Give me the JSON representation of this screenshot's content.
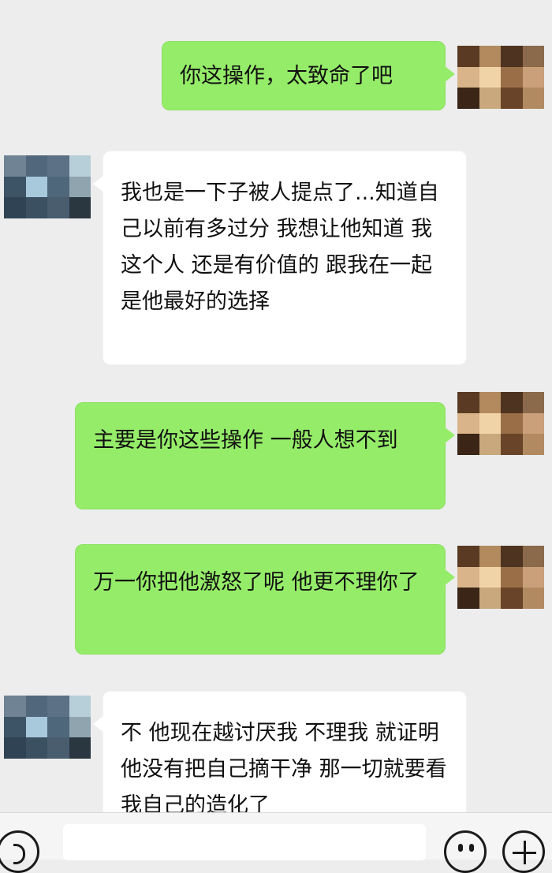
{
  "messages": [
    {
      "sender": "me",
      "text": "你这操作，太致命了吧"
    },
    {
      "sender": "them",
      "text": "我也是一下子被人提点了...知道自己以前有多过分 我想让他知道 我这个人 还是有价值的 跟我在一起 是他最好的选择"
    },
    {
      "sender": "me",
      "text": "主要是你这些操作 一般人想不到"
    },
    {
      "sender": "me",
      "text": "万一你把他激怒了呢 他更不理你了"
    },
    {
      "sender": "them",
      "text": "不 他现在越讨厌我 不理我 就证明他没有把自己摘干净 那一切就要看我自己的造化了"
    }
  ],
  "avatars": {
    "me": [
      "#5a3a22",
      "#b38a5e",
      "#4e3320",
      "#8a6a4a",
      "#d9b48a",
      "#f1d3a8",
      "#9a6f48",
      "#c9a07a",
      "#3a2516",
      "#c9a87e",
      "#6a4428",
      "#b28a62"
    ],
    "them": [
      "#6f8394",
      "#51687c",
      "#5d7186",
      "#b7cfd9",
      "#3d5466",
      "#a8c8dc",
      "#4f677b",
      "#8fa4ae",
      "#2f4354",
      "#3b5061",
      "#4a5d6e",
      "#2a3640"
    ]
  },
  "input_bar": {
    "voice_icon": "voice-icon",
    "emoji_icon": "emoji-icon",
    "plus_icon": "plus-icon",
    "input_value": ""
  }
}
